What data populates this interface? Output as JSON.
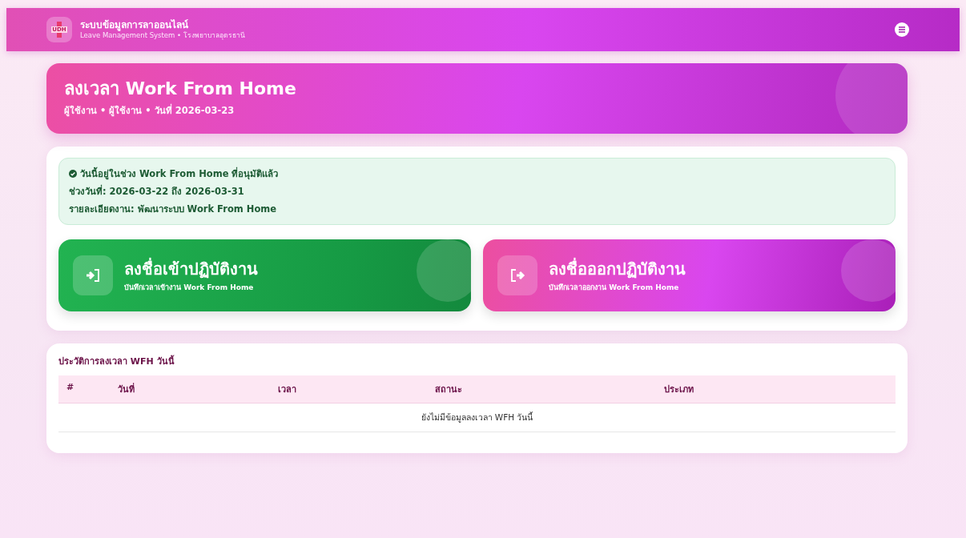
{
  "navbar": {
    "logo_text": "UDH",
    "title": "ระบบข้อมูลการลาออนไลน์",
    "subtitle": "Leave Management System • โรงพยาบาลอุดรธานี"
  },
  "header": {
    "title": "ลงเวลา Work From Home",
    "subtitle": "ผู้ใช้งาน • ผู้ใช้งาน • วันที่ 2026-03-23"
  },
  "notice": {
    "lines": [
      "วันนี้อยู่ในช่วง Work From Home ที่อนุมัติแล้ว",
      "ช่วงวันที่: 2026-03-22 ถึง 2026-03-31",
      "รายละเอียดงาน: พัฒนาระบบ Work From Home"
    ]
  },
  "actions": [
    {
      "kind": "check_in",
      "title": "ลงชื่อเข้าปฏิบัติงาน",
      "subtitle": "บันทึกเวลาเข้างาน Work From Home"
    },
    {
      "kind": "check_out",
      "title": "ลงชื่อออกปฏิบัติงาน",
      "subtitle": "บันทึกเวลาออกงาน Work From Home"
    }
  ],
  "history": {
    "title": "ประวัติการลงเวลา WFH วันนี้",
    "table": {
      "columns": [
        "#",
        "วันที่",
        "เวลา",
        "สถานะ",
        "ประเภท"
      ],
      "empty_message": "ยังไม่มีข้อมูลลงเวลา WFH วันนี้"
    }
  }
}
